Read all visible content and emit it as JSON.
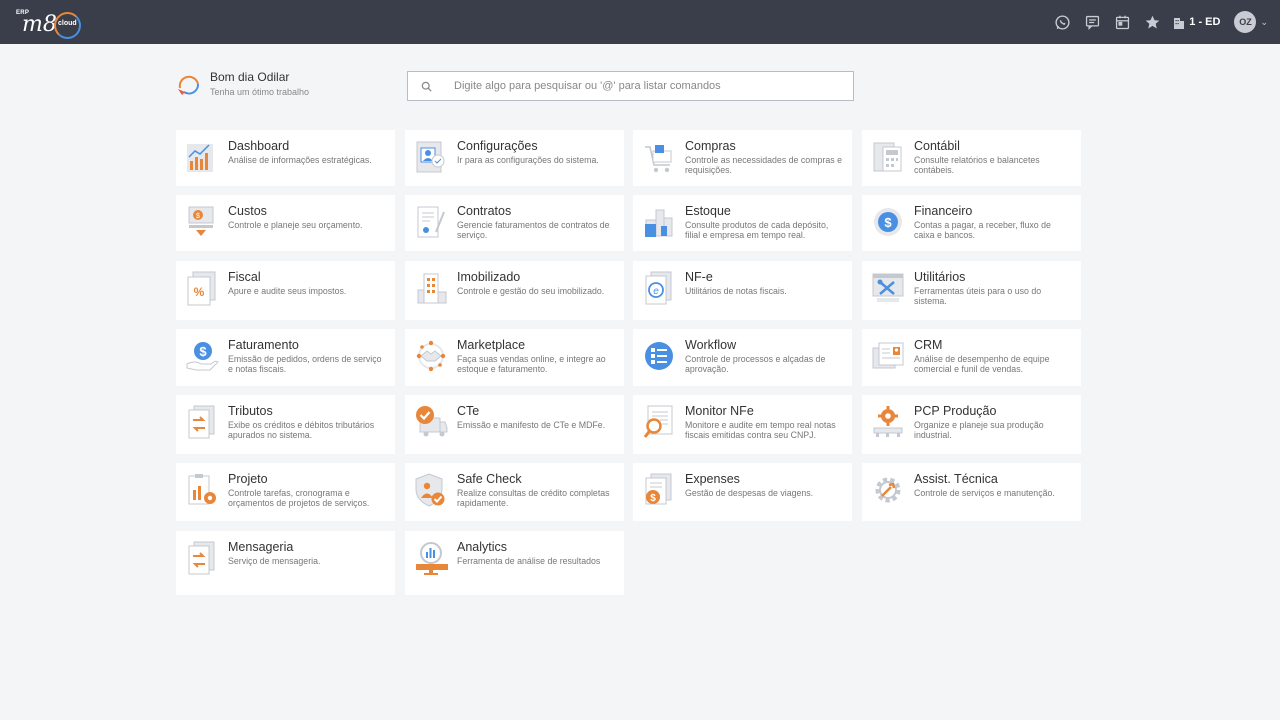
{
  "header": {
    "logo": {
      "erp": "ERP",
      "brand": "m8",
      "cloud": "cloud"
    },
    "actions": [
      {
        "icon": "whatsapp-icon"
      },
      {
        "icon": "chat-icon"
      },
      {
        "icon": "calendar-icon"
      },
      {
        "icon": "star-icon"
      }
    ],
    "company": "1 - ED",
    "user_initials": "OZ"
  },
  "greeting": {
    "title": "Bom dia Odilar",
    "subtitle": "Tenha um ótimo trabalho"
  },
  "search": {
    "placeholder": "Digite algo para pesquisar ou '@' para listar comandos",
    "value": ""
  },
  "colors": {
    "accent": "#e8873a",
    "blue": "#4a90e2",
    "topbar": "#3a3e4a"
  },
  "modules": [
    {
      "title": "Dashboard",
      "desc": "Análise de informações estratégicas.",
      "icon": "dashboard-icon"
    },
    {
      "title": "Configurações",
      "desc": "Ir para as configurações do sistema.",
      "icon": "settings-icon"
    },
    {
      "title": "Compras",
      "desc": "Controle as necessidades de compras e requisições.",
      "icon": "cart-icon"
    },
    {
      "title": "Contábil",
      "desc": "Consulte relatórios e balancetes contábeis.",
      "icon": "calculator-icon"
    },
    {
      "title": "Custos",
      "desc": "Controle e planeje seu orçamento.",
      "icon": "costs-icon"
    },
    {
      "title": "Contratos",
      "desc": "Gerencie faturamentos de contratos de serviço.",
      "icon": "contract-icon"
    },
    {
      "title": "Estoque",
      "desc": "Consulte produtos de cada depósito, filial e empresa em tempo real.",
      "icon": "warehouse-icon"
    },
    {
      "title": "Financeiro",
      "desc": "Contas a pagar, a receber, fluxo de caixa e bancos.",
      "icon": "money-icon"
    },
    {
      "title": "Fiscal",
      "desc": "Apure e audite seus impostos.",
      "icon": "percent-icon"
    },
    {
      "title": "Imobilizado",
      "desc": "Controle e gestão do seu imobilizado.",
      "icon": "building-icon"
    },
    {
      "title": "NF-e",
      "desc": "Utilitários de notas fiscais.",
      "icon": "nfe-icon"
    },
    {
      "title": "Utilitários",
      "desc": "Ferramentas úteis para o uso do sistema.",
      "icon": "tools-icon"
    },
    {
      "title": "Faturamento",
      "desc": "Emissão de pedidos, ordens de serviço e notas fiscais.",
      "icon": "billing-icon"
    },
    {
      "title": "Marketplace",
      "desc": "Faça suas vendas online, e integre ao estoque e faturamento.",
      "icon": "handshake-icon"
    },
    {
      "title": "Workflow",
      "desc": "Controle de processos e alçadas de aprovação.",
      "icon": "workflow-icon"
    },
    {
      "title": "CRM",
      "desc": "Análise de desempenho de equipe comercial e funil de vendas.",
      "icon": "crm-icon"
    },
    {
      "title": "Tributos",
      "desc": "Exibe os créditos e débitos tributários apurados no sistema.",
      "icon": "exchange-icon"
    },
    {
      "title": "CTe",
      "desc": "Emissão e manifesto de CTe e MDFe.",
      "icon": "truck-icon"
    },
    {
      "title": "Monitor NFe",
      "desc": "Monitore e audite em tempo real notas fiscais emitidas contra seu CNPJ.",
      "icon": "monitor-icon"
    },
    {
      "title": "PCP Produção",
      "desc": "Organize e planeje sua produção industrial.",
      "icon": "production-icon"
    },
    {
      "title": "Projeto",
      "desc": "Controle tarefas, cronograma e orçamentos de projetos de serviços.",
      "icon": "project-icon"
    },
    {
      "title": "Safe Check",
      "desc": "Realize consultas de crédito completas rapidamente.",
      "icon": "shield-icon"
    },
    {
      "title": "Expenses",
      "desc": "Gestão de despesas de viagens.",
      "icon": "expenses-icon"
    },
    {
      "title": "Assist. Técnica",
      "desc": "Controle de serviços e manutenção.",
      "icon": "gear-icon"
    },
    {
      "title": "Mensageria",
      "desc": "Serviço de mensageria.",
      "icon": "messaging-icon"
    },
    {
      "title": "Analytics",
      "desc": "Ferramenta de análise de resultados",
      "icon": "analytics-icon"
    }
  ]
}
